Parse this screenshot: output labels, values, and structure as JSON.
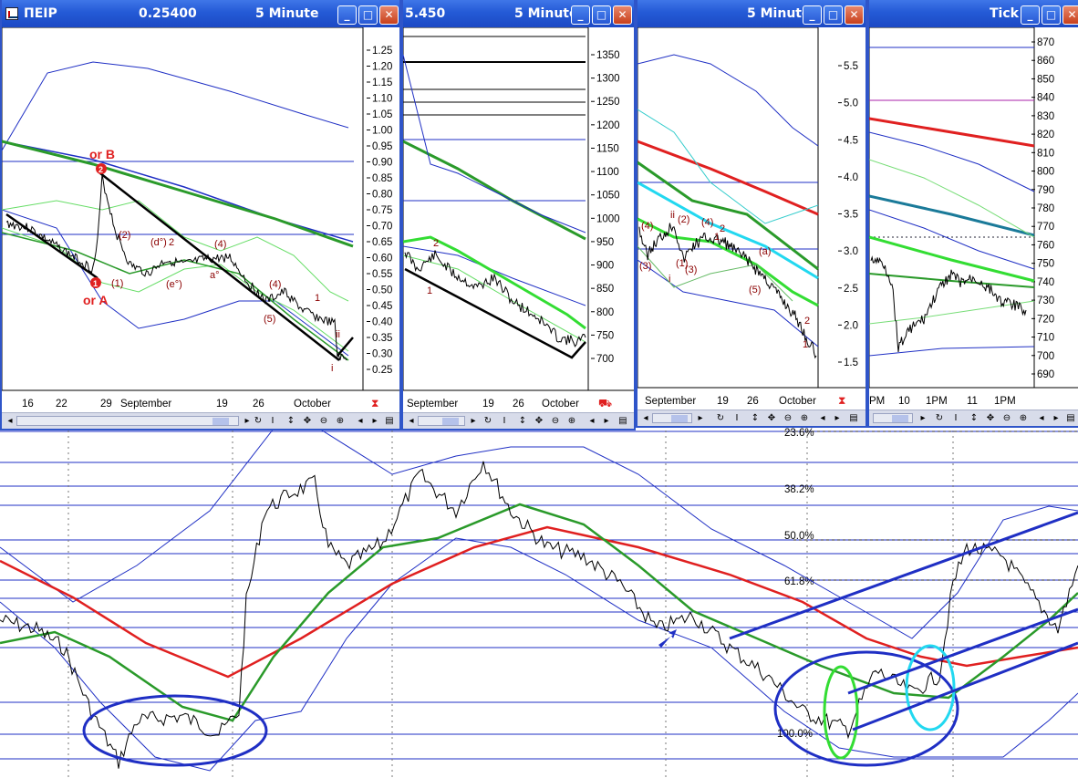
{
  "colors": {
    "titlebar": "#245ad6",
    "price": "#000000",
    "bollinger": "#1f2fc4",
    "ma_fast": "#2a9a2a",
    "ma_slow": "#e02020",
    "bright_green": "#33dd33",
    "cyan": "#22d8f0",
    "ellipse_blue": "#1f2fc4",
    "wave_label": "#8b0000"
  },
  "main": {
    "fib_labels": [
      "23.6%",
      "38.2%",
      "50.0%",
      "61.8%",
      "100.0%"
    ],
    "annotations": {
      "ellipse_left": "blue-ellipse",
      "ellipse_right_blue": "blue-ellipse",
      "ellipse_green": "green-ellipse",
      "ellipse_cyan": "cyan-ellipse",
      "arrow": "blue-arrow"
    }
  },
  "windows": [
    {
      "id": "w1",
      "title": "ΠΕΙΡ",
      "value": "0.25400",
      "interval": "5 Minute",
      "y_ticks": [
        "1.25",
        "1.20",
        "1.15",
        "1.10",
        "1.05",
        "1.00",
        "0.95",
        "0.90",
        "0.85",
        "0.80",
        "0.75",
        "0.70",
        "0.65",
        "0.60",
        "0.55",
        "0.50",
        "0.45",
        "0.40",
        "0.35",
        "0.30",
        "0.25"
      ],
      "x_labels": [
        "16",
        "22",
        "29",
        "September",
        "19",
        "26",
        "October"
      ],
      "waves": {
        "or_b": "or B",
        "or_a": "or A",
        "circle_1": "1",
        "circle_2": "2",
        "labels": [
          "(1)",
          "(2)",
          "(d°)",
          "2",
          "(e°)",
          "(4)",
          "(4)",
          "(5)",
          "1",
          "a°",
          "ii",
          "i"
        ]
      }
    },
    {
      "id": "w2",
      "title": "5.450",
      "interval": "5 Minute",
      "y_ticks": [
        "1350",
        "1300",
        "1250",
        "1200",
        "1150",
        "1100",
        "1050",
        "1000",
        "950",
        "900",
        "850",
        "800",
        "750",
        "700"
      ],
      "x_labels": [
        "September",
        "19",
        "26",
        "October"
      ],
      "waves": {
        "labels": [
          "2",
          "1"
        ]
      }
    },
    {
      "id": "w3",
      "interval": "5 Minute",
      "y_ticks": [
        "5.5",
        "5.0",
        "4.5",
        "4.0",
        "3.5",
        "3.0",
        "2.5",
        "2.0",
        "1.5"
      ],
      "x_labels": [
        "September",
        "19",
        "26",
        "October"
      ],
      "waves": {
        "labels": [
          "(4)",
          "ii",
          "(2)",
          "(4)",
          "2",
          "(3)",
          "(1)",
          "(3)",
          "i",
          "1",
          "(5)",
          "(a)",
          "2",
          "1"
        ]
      }
    },
    {
      "id": "w4",
      "interval": "Tick",
      "y_ticks": [
        "870",
        "860",
        "850",
        "840",
        "830",
        "820",
        "810",
        "800",
        "790",
        "780",
        "770",
        "760",
        "750",
        "740",
        "730",
        "720",
        "710",
        "700",
        "690"
      ],
      "x_labels": [
        "PM",
        "10",
        "1PM",
        "11",
        "1PM"
      ]
    }
  ],
  "chart_data": [
    {
      "type": "line",
      "panel": "main",
      "description_series": [
        "price",
        "upper_band",
        "lower_band",
        "ma_fast",
        "ma_slow"
      ],
      "fibonacci_levels": [
        23.6,
        38.2,
        50.0,
        61.8,
        100.0
      ],
      "x": [
        0,
        50,
        100,
        150,
        200,
        250,
        300,
        350,
        400,
        450,
        500,
        550,
        600,
        650,
        700,
        750,
        800,
        850,
        900,
        950,
        1000,
        1050,
        1100,
        1150,
        1182
      ],
      "series": [
        {
          "key": "price",
          "values": [
            680,
            690,
            760,
            820,
            810,
            800,
            560,
            620,
            560,
            520,
            500,
            600,
            610,
            650,
            690,
            700,
            690,
            760,
            790,
            770,
            740,
            620,
            600,
            680,
            620
          ]
        },
        {
          "key": "ma_fast",
          "values": [
            710,
            690,
            700,
            760,
            790,
            790,
            690,
            600,
            590,
            580,
            560,
            560,
            600,
            650,
            680,
            700,
            730,
            760,
            780,
            770,
            760,
            730,
            700,
            670,
            650
          ]
        },
        {
          "key": "ma_slow",
          "values": [
            620,
            650,
            690,
            720,
            740,
            730,
            700,
            660,
            620,
            590,
            580,
            580,
            590,
            600,
            620,
            650,
            670,
            690,
            700,
            710,
            720,
            730,
            720,
            715,
            712
          ]
        }
      ]
    },
    {
      "type": "line",
      "panel": "w1",
      "ylim": [
        0.25,
        1.25
      ],
      "price": [
        0.7,
        0.68,
        0.66,
        0.62,
        0.58,
        0.55,
        0.83,
        0.62,
        0.58,
        0.56,
        0.6,
        0.62,
        0.6,
        0.62,
        0.6,
        0.58,
        0.5,
        0.47,
        0.48,
        0.42,
        0.4,
        0.38,
        0.36,
        0.3,
        0.26
      ]
    },
    {
      "type": "line",
      "panel": "w2",
      "ylim": [
        700,
        1350
      ],
      "price": [
        920,
        910,
        900,
        940,
        880,
        870,
        860,
        850,
        830,
        820,
        800,
        790,
        780,
        770,
        760,
        740,
        730,
        720,
        710,
        700,
        730
      ]
    },
    {
      "type": "line",
      "panel": "w3",
      "ylim": [
        1.5,
        5.5
      ],
      "price": [
        3.0,
        2.8,
        3.2,
        2.9,
        3.1,
        3.05,
        3.0,
        2.95,
        2.9,
        2.7,
        2.6,
        2.5,
        2.3,
        2.1,
        2.0,
        1.8,
        1.6
      ]
    },
    {
      "type": "line",
      "panel": "w4",
      "ylim": [
        690,
        870
      ],
      "price": [
        745,
        740,
        735,
        710,
        715,
        722,
        730,
        738,
        735,
        740,
        732,
        728,
        735,
        730,
        725,
        722,
        724,
        720,
        723
      ]
    }
  ]
}
